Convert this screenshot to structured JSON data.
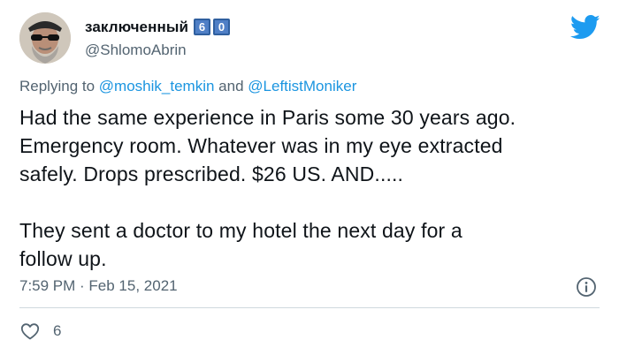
{
  "user": {
    "display_name": "заключенный",
    "badges": [
      "6",
      "0"
    ],
    "handle": "@ShlomoAbrin"
  },
  "reply": {
    "prefix": "Replying to",
    "mention_1": "@moshik_temkin",
    "conjunction": "and",
    "mention_2": "@LeftistMoniker"
  },
  "tweet": {
    "lines": [
      "Had the same experience in Paris some 30 years ago.",
      "Emergency room. Whatever was in my eye extracted",
      "safely. Drops prescribed. $26 US. AND.....",
      "They sent a doctor to my hotel the next day for a",
      "follow up."
    ],
    "timestamp": "7:59 PM · Feb 15, 2021"
  },
  "stats": {
    "likes": "6"
  },
  "icons": {
    "brand": "twitter-bird-icon",
    "info": "info-icon",
    "like": "heart-icon"
  },
  "colors": {
    "brand": "#1d9bf0",
    "link": "#1b95e0",
    "secondary_text": "#536471",
    "badge": "#4f7fc6"
  }
}
